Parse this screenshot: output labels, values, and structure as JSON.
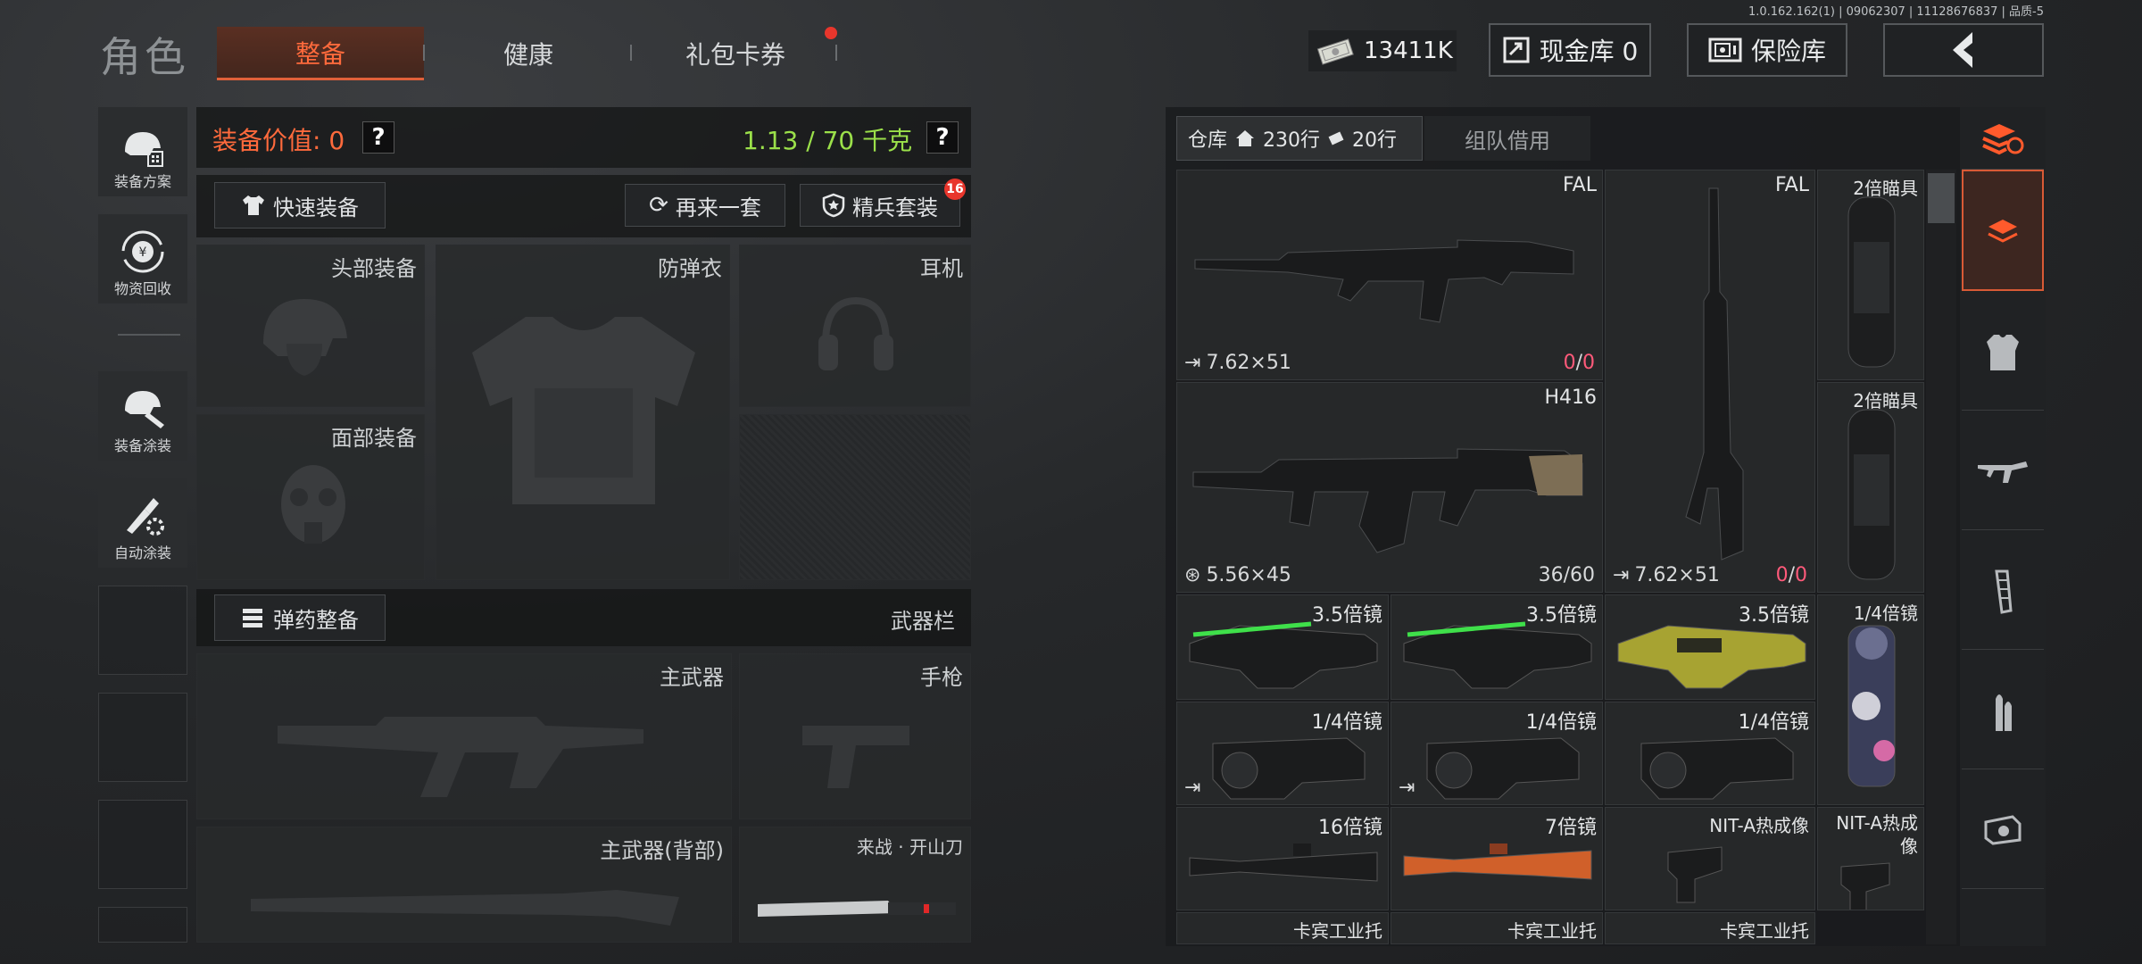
{
  "version": "1.0.162.162(1) | 09062307 | 11128676837 | 品质-5",
  "page_title": "角色",
  "tabs": [
    {
      "label": "整备"
    },
    {
      "label": "健康"
    },
    {
      "label": "礼包卡券"
    }
  ],
  "currency": {
    "label": "13411K"
  },
  "cash_vault": {
    "label": "现金库 0"
  },
  "safe_vault": {
    "label": "保险库"
  },
  "sidebar": [
    {
      "label": "装备方案"
    },
    {
      "label": "物资回收"
    },
    {
      "label": "装备涂装"
    },
    {
      "label": "自动涂装"
    }
  ],
  "equip": {
    "value_label": "装备价值: 0",
    "weight_label": "1.13 / 70 千克",
    "help": "?",
    "quick_equip": "快速装备",
    "again": "再来一套",
    "elite": "精兵套装",
    "elite_badge": "16",
    "ammo_prep": "弹药整备",
    "weapon_bar": "武器栏"
  },
  "slots": {
    "head": "头部装备",
    "vest": "防弹衣",
    "earphone": "耳机",
    "face": "面部装备",
    "primary": "主武器",
    "pistol": "手枪",
    "primary_back": "主武器(背部)",
    "melee": "来战 · 开山刀"
  },
  "warehouse": {
    "tab_label": "仓库",
    "rows_label": "230行",
    "extra_label": "20行",
    "team_tab": "组队借用"
  },
  "items": {
    "fal_a": {
      "name": "FAL",
      "ammo": "7.62×51",
      "count_a": "0",
      "count_b": "0"
    },
    "fal_b": {
      "name": "FAL",
      "ammo": "7.62×51",
      "count_a": "0",
      "count_b": "0"
    },
    "scope2x_a": {
      "name": "2倍瞄具"
    },
    "scope2x_b": {
      "name": "2倍瞄具"
    },
    "h416": {
      "name": "H416",
      "ammo": "5.56×45",
      "count": "36/60"
    },
    "s35_a": {
      "name": "3.5倍镜"
    },
    "s35_b": {
      "name": "3.5倍镜"
    },
    "s35_c": {
      "name": "3.5倍镜"
    },
    "s14_a": {
      "name": "1/4倍镜"
    },
    "s14_b": {
      "name": "1/4倍镜"
    },
    "s14_c": {
      "name": "1/4倍镜"
    },
    "s14_d": {
      "name": "1/4倍镜"
    },
    "s16": {
      "name": "16倍镜"
    },
    "s7": {
      "name": "7倍镜"
    },
    "nit_a": {
      "name": "NIT-A热成像"
    },
    "nit_b": {
      "name": "NIT-A热成像"
    },
    "stock_a": {
      "name": "卡宾工业托"
    },
    "stock_b": {
      "name": "卡宾工业托"
    },
    "stock_c": {
      "name": "卡宾工业托"
    }
  },
  "colors": {
    "accent": "#ff6a3c",
    "weight": "#9be04a",
    "count_red": "#ff5a7a"
  }
}
